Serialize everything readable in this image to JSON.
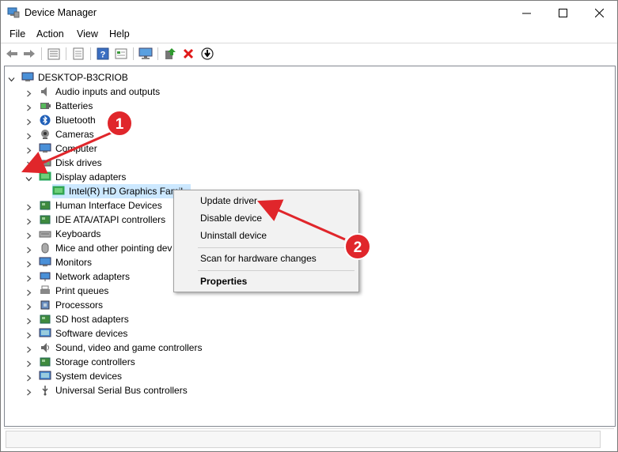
{
  "window": {
    "title": "Device Manager",
    "controls": [
      "minimize",
      "maximize",
      "close"
    ]
  },
  "menu": [
    "File",
    "Action",
    "View",
    "Help"
  ],
  "toolbar": {
    "icons": [
      "back-arrow-icon",
      "forward-arrow-icon",
      "show-hidden-icon",
      "properties-icon",
      "help-icon",
      "view-resources-icon",
      "monitor-icon",
      "update-driver-icon",
      "uninstall-icon",
      "download-icon"
    ]
  },
  "tree": {
    "root": "DESKTOP-B3CRIOB",
    "categories": [
      {
        "label": "Audio inputs and outputs",
        "icon": "speaker-icon"
      },
      {
        "label": "Batteries",
        "icon": "battery-icon"
      },
      {
        "label": "Bluetooth",
        "icon": "bluetooth-icon"
      },
      {
        "label": "Cameras",
        "icon": "camera-icon"
      },
      {
        "label": "Computer",
        "icon": "computer-icon"
      },
      {
        "label": "Disk drives",
        "icon": "disk-drive-icon"
      },
      {
        "label": "Display adapters",
        "icon": "display-adapter-icon",
        "expanded": true
      },
      {
        "label": "Human Interface Devices",
        "icon": "hid-icon"
      },
      {
        "label": "IDE ATA/ATAPI controllers",
        "icon": "ide-controller-icon"
      },
      {
        "label": "Keyboards",
        "icon": "keyboard-icon"
      },
      {
        "label": "Mice and other pointing dev",
        "icon": "mouse-icon"
      },
      {
        "label": "Monitors",
        "icon": "monitor-icon"
      },
      {
        "label": "Network adapters",
        "icon": "network-adapter-icon"
      },
      {
        "label": "Print queues",
        "icon": "printer-icon"
      },
      {
        "label": "Processors",
        "icon": "processor-icon"
      },
      {
        "label": "SD host adapters",
        "icon": "sd-adapter-icon"
      },
      {
        "label": "Software devices",
        "icon": "software-device-icon"
      },
      {
        "label": "Sound, video and game controllers",
        "icon": "sound-controller-icon"
      },
      {
        "label": "Storage controllers",
        "icon": "storage-controller-icon"
      },
      {
        "label": "System devices",
        "icon": "system-device-icon"
      },
      {
        "label": "Universal Serial Bus controllers",
        "icon": "usb-icon"
      }
    ],
    "child": "Intel(R) HD Graphics Famil"
  },
  "context_menu": {
    "items": [
      "Update driver",
      "Disable device",
      "Uninstall device",
      "Scan for hardware changes",
      "Properties"
    ]
  },
  "annotations": {
    "badge_1": "1",
    "badge_2": "2",
    "color": "#e0262b"
  }
}
